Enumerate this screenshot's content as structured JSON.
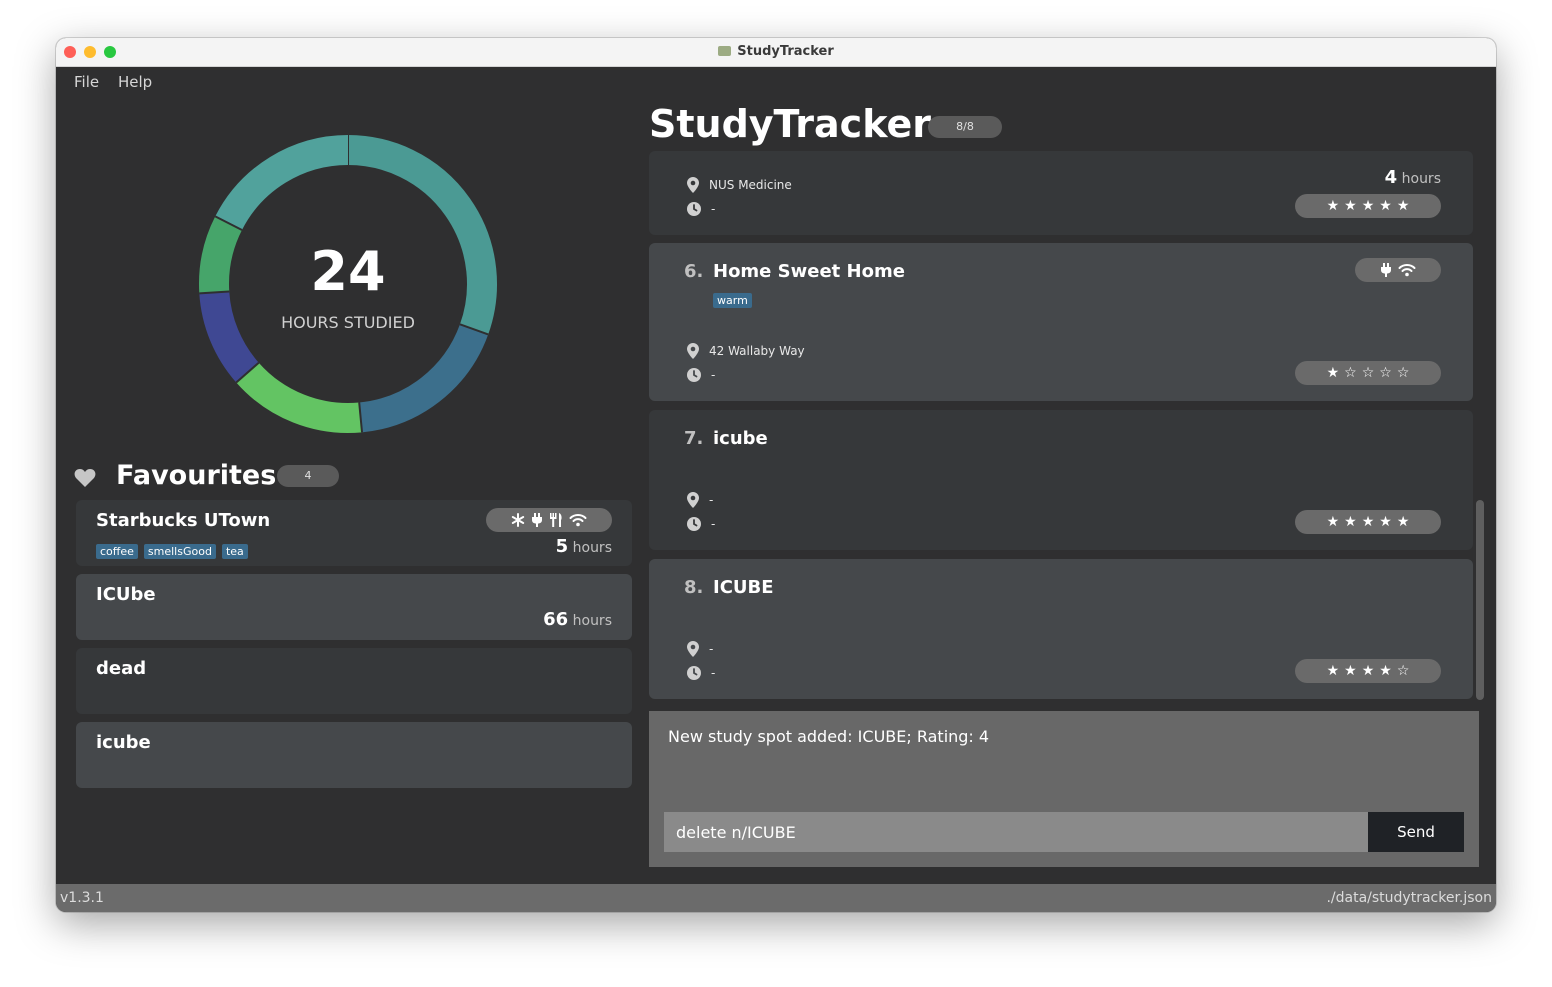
{
  "window": {
    "title": "StudyTracker"
  },
  "menu": {
    "file": "File",
    "help": "Help"
  },
  "summary": {
    "hours": "24",
    "label": "HOURS STUDIED"
  },
  "donut_segments": [
    {
      "fraction": 0.305,
      "color": "#4b9a94"
    },
    {
      "fraction": 0.18,
      "color": "#3c6f8c"
    },
    {
      "fraction": 0.15,
      "color": "#63c463"
    },
    {
      "fraction": 0.105,
      "color": "#3f4893"
    },
    {
      "fraction": 0.085,
      "color": "#46a56a"
    },
    {
      "fraction": 0.175,
      "color": "#51a29c"
    }
  ],
  "favourites": {
    "title": "Favourites",
    "count": "4",
    "items": [
      {
        "name": "Starbucks UTown",
        "tags": [
          "coffee",
          "smellsGood",
          "tea"
        ],
        "hours_value": "5",
        "hours_unit": "hours"
      },
      {
        "name": "ICUbe",
        "hours_value": "66",
        "hours_unit": "hours"
      },
      {
        "name": "dead"
      },
      {
        "name": "icube"
      }
    ]
  },
  "header": {
    "title": "StudyTracker",
    "count": "8/8"
  },
  "spots": [
    {
      "location": "NUS Medicine",
      "time": "-",
      "hours_value": "4",
      "hours_unit": "hours",
      "rating": 5
    },
    {
      "index": "6.",
      "name": "Home Sweet Home",
      "tag": "warm",
      "location": "42 Wallaby Way",
      "time": "-",
      "rating": 1
    },
    {
      "index": "7.",
      "name": "icube",
      "location": "-",
      "time": "-",
      "rating": 5
    },
    {
      "index": "8.",
      "name": "ICUBE",
      "location": "-",
      "time": "-",
      "rating": 4
    }
  ],
  "result": "New study spot added: ICUBE; Rating: 4",
  "command": {
    "value": "delete n/ICUBE",
    "send": "Send"
  },
  "status": {
    "version": "v1.3.1",
    "path": "./data/studytracker.json"
  }
}
